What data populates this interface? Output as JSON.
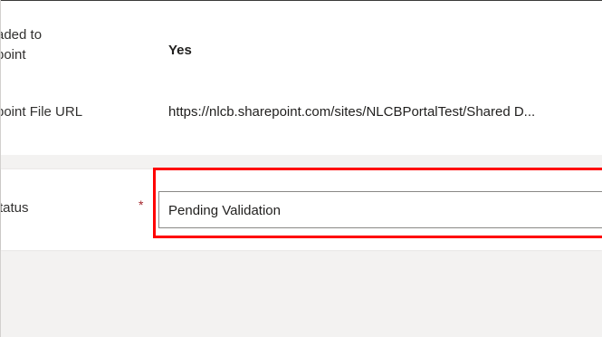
{
  "fields": {
    "uploaded": {
      "label_line1": "aded to",
      "label_line2": "point",
      "value": "Yes"
    },
    "file_url": {
      "label": "point File URL",
      "value": "https://nlcb.sharepoint.com/sites/NLCBPortalTest/Shared D..."
    },
    "status": {
      "label": "tatus",
      "required_marker": "*",
      "value": "Pending Validation"
    }
  },
  "colors": {
    "highlight": "#ff0000",
    "required": "#a4262c"
  }
}
